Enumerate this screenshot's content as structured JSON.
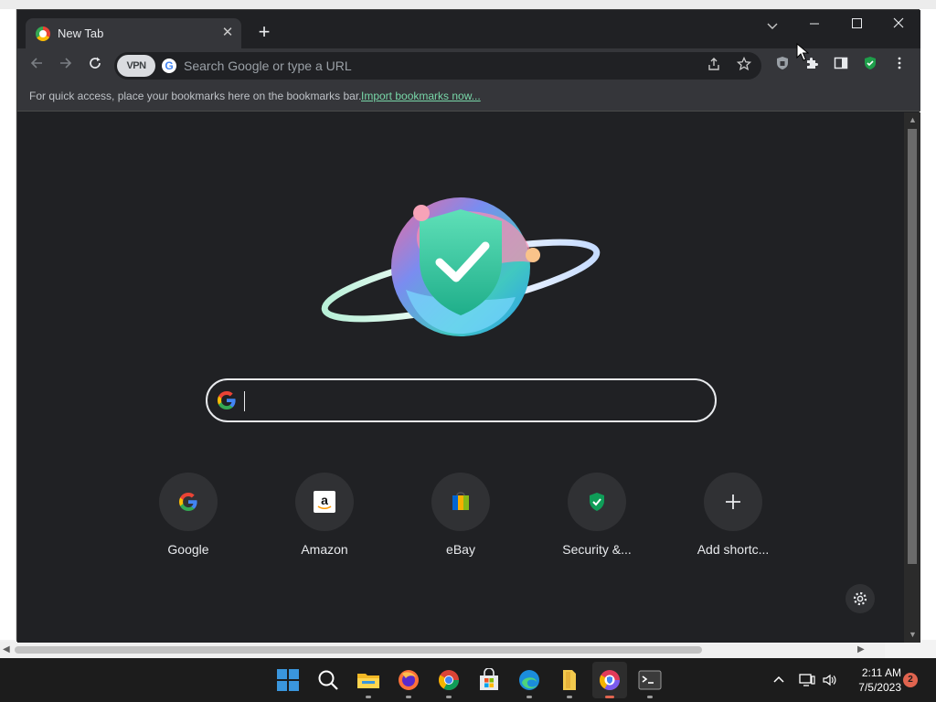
{
  "browser": {
    "tab": {
      "title": "New Tab",
      "close": "✕"
    },
    "new_tab": "+",
    "window_controls": {
      "minimize": "—",
      "maximize": "☐",
      "close": "✕",
      "tab_search": "⌄"
    },
    "toolbar": {
      "vpn_label": "VPN",
      "omnibox_placeholder": "Search Google or type a URL"
    },
    "bookmarks_bar": {
      "message": "For quick access, place your bookmarks here on the bookmarks bar.",
      "import_link": "Import bookmarks now..."
    }
  },
  "new_tab_page": {
    "search_value": "",
    "shortcuts": [
      {
        "label": "Google",
        "icon": "google-icon"
      },
      {
        "label": "Amazon",
        "icon": "amazon-icon"
      },
      {
        "label": "eBay",
        "icon": "ebay-icon"
      },
      {
        "label": "Security &...",
        "icon": "security-shield-icon"
      },
      {
        "label": "Add shortc...",
        "icon": "plus-icon"
      }
    ],
    "settings": "⚙"
  },
  "taskbar": {
    "time": "2:11 AM",
    "date": "7/5/2023",
    "notifications": "2",
    "apps": [
      "start",
      "search",
      "file-explorer",
      "firefox",
      "chrome",
      "microsoft-store",
      "edge",
      "file-manager",
      "secure-browser",
      "terminal"
    ]
  },
  "colors": {
    "window_bg": "#202124",
    "toolbar_bg": "#35363a",
    "link_color": "#78d7a8",
    "taskbar_bg": "#1c1c1c"
  }
}
